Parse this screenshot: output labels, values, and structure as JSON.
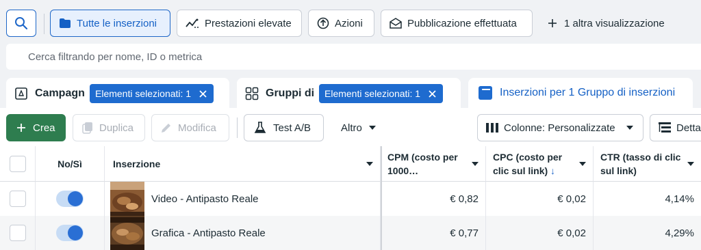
{
  "views": {
    "search_icon": "search-icon",
    "all_ads": "Tutte le inserzioni",
    "high_performance": "Prestazioni elevate",
    "actions": "Azioni",
    "published": "Pubblicazione effettuata",
    "more_views": "1 altra visualizzazione"
  },
  "filter": {
    "placeholder": "Cerca filtrando per nome, ID o metrica"
  },
  "levels": {
    "campaigns": {
      "label": "Campagne",
      "chip": "Elementi selezionati: 1"
    },
    "adsets": {
      "label": "Gruppi di inserzioni",
      "chip": "Elementi selezionati: 1"
    },
    "ads": {
      "label": "Inserzioni per 1 Gruppo di inserzioni"
    }
  },
  "toolbar": {
    "create": "Crea",
    "duplicate": "Duplica",
    "edit": "Modifica",
    "ab_test": "Test A/B",
    "more": "Altro",
    "columns": "Colonne: Personalizzate",
    "breakdown": "Dettaglio"
  },
  "table": {
    "headers": {
      "toggle": "No/Sì",
      "name": "Inserzione",
      "cpm": "CPM (costo per 1000…",
      "cpc": "CPC (costo per clic sul link)",
      "ctr": "CTR (tasso di clic sul link)"
    },
    "rows": [
      {
        "name": "Video - Antipasto Reale",
        "cpm": "€ 0,82",
        "cpc": "€ 0,02",
        "ctr": "4,14%",
        "active": true
      },
      {
        "name": "Grafica - Antipasto Reale",
        "cpm": "€ 0,77",
        "cpc": "€ 0,02",
        "ctr": "4,29%",
        "active": true
      }
    ]
  },
  "colors": {
    "accent": "#1d66c8",
    "create_green": "#2e7d4f",
    "chip_blue": "#1e6bcf"
  }
}
